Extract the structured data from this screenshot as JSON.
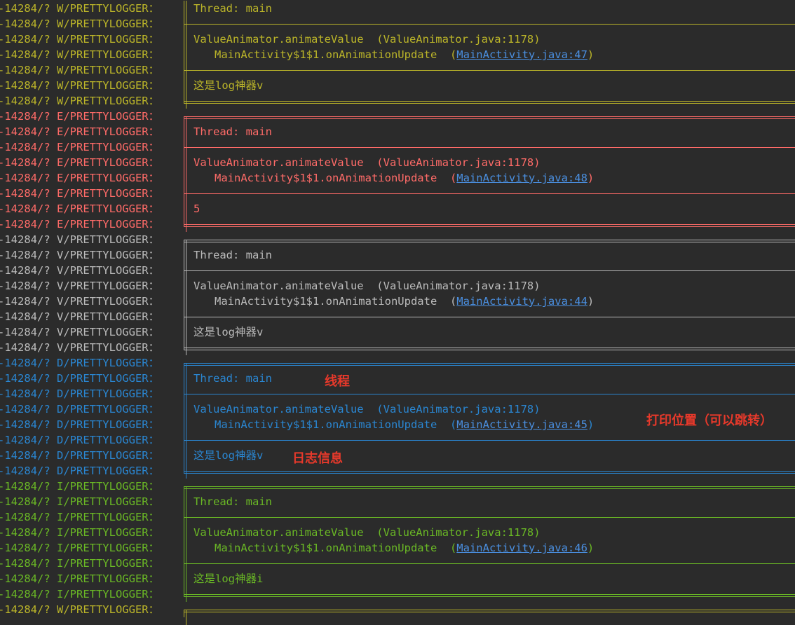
{
  "prefix_template": "-14284/? {L}/PRETTYLOGGER：",
  "colors": {
    "W": "#bbb529",
    "E": "#ff6b68",
    "V": "#bbbbbb",
    "D": "#2a86d1",
    "I": "#6ab825",
    "link": "#4a8fe0",
    "annotation": "#e8392b",
    "background": "#2b2b2b"
  },
  "lines": [
    {
      "level": "W",
      "type": "text",
      "text": "Thread: main"
    },
    {
      "level": "W",
      "type": "divider"
    },
    {
      "level": "W",
      "type": "text",
      "text": "ValueAnimator.animateValue  (ValueAnimator.java:1178)"
    },
    {
      "level": "W",
      "type": "trace",
      "method": "MainActivity$1$1.onAnimationUpdate",
      "link": "MainActivity.java:47"
    },
    {
      "level": "W",
      "type": "divider"
    },
    {
      "level": "W",
      "type": "text",
      "text": "这是log神器v"
    },
    {
      "level": "W",
      "type": "bottom"
    },
    {
      "level": "E",
      "type": "top"
    },
    {
      "level": "E",
      "type": "text",
      "text": "Thread: main"
    },
    {
      "level": "E",
      "type": "divider"
    },
    {
      "level": "E",
      "type": "text",
      "text": "ValueAnimator.animateValue  (ValueAnimator.java:1178)"
    },
    {
      "level": "E",
      "type": "trace",
      "method": "MainActivity$1$1.onAnimationUpdate",
      "link": "MainActivity.java:48"
    },
    {
      "level": "E",
      "type": "divider"
    },
    {
      "level": "E",
      "type": "text",
      "text": "5"
    },
    {
      "level": "E",
      "type": "bottom"
    },
    {
      "level": "V",
      "type": "top"
    },
    {
      "level": "V",
      "type": "text",
      "text": "Thread: main"
    },
    {
      "level": "V",
      "type": "divider"
    },
    {
      "level": "V",
      "type": "text",
      "text": "ValueAnimator.animateValue  (ValueAnimator.java:1178)"
    },
    {
      "level": "V",
      "type": "trace",
      "method": "MainActivity$1$1.onAnimationUpdate",
      "link": "MainActivity.java:44"
    },
    {
      "level": "V",
      "type": "divider"
    },
    {
      "level": "V",
      "type": "text",
      "text": "这是log神器v"
    },
    {
      "level": "V",
      "type": "bottom"
    },
    {
      "level": "D",
      "type": "top"
    },
    {
      "level": "D",
      "type": "text",
      "text": "Thread: main"
    },
    {
      "level": "D",
      "type": "divider"
    },
    {
      "level": "D",
      "type": "text",
      "text": "ValueAnimator.animateValue  (ValueAnimator.java:1178)"
    },
    {
      "level": "D",
      "type": "trace",
      "method": "MainActivity$1$1.onAnimationUpdate",
      "link": "MainActivity.java:45"
    },
    {
      "level": "D",
      "type": "divider"
    },
    {
      "level": "D",
      "type": "text",
      "text": "这是log神器v"
    },
    {
      "level": "D",
      "type": "bottom"
    },
    {
      "level": "I",
      "type": "top"
    },
    {
      "level": "I",
      "type": "text",
      "text": "Thread: main"
    },
    {
      "level": "I",
      "type": "divider"
    },
    {
      "level": "I",
      "type": "text",
      "text": "ValueAnimator.animateValue  (ValueAnimator.java:1178)"
    },
    {
      "level": "I",
      "type": "trace",
      "method": "MainActivity$1$1.onAnimationUpdate",
      "link": "MainActivity.java:46"
    },
    {
      "level": "I",
      "type": "divider"
    },
    {
      "level": "I",
      "type": "text",
      "text": "这是log神器i"
    },
    {
      "level": "I",
      "type": "bottom"
    },
    {
      "level": "W",
      "type": "top"
    }
  ],
  "annotations": {
    "thread": "线程",
    "location": "打印位置（可以跳转）",
    "message": "日志信息"
  }
}
